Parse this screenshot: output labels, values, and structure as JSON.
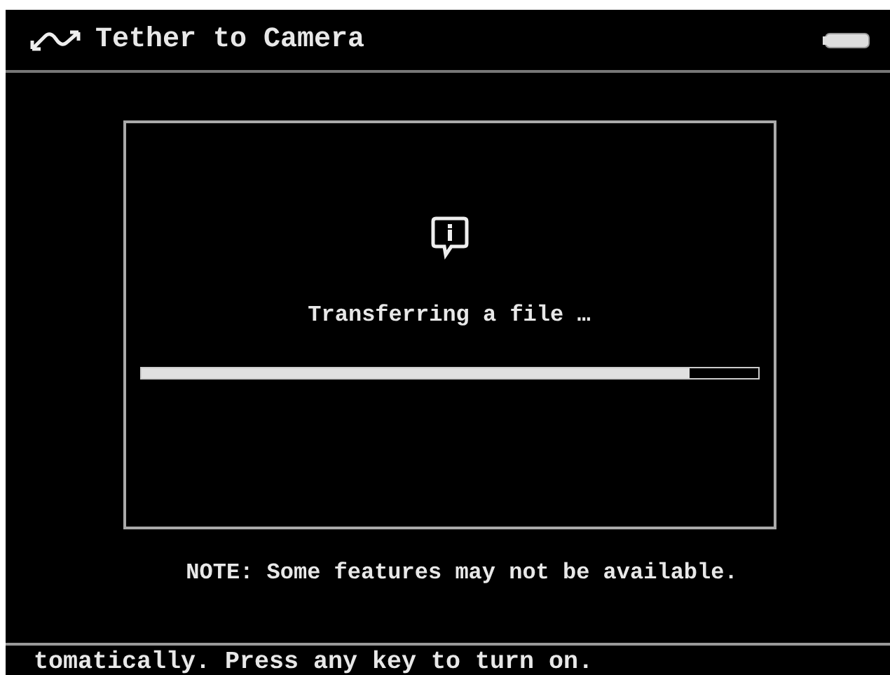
{
  "header": {
    "title": "Tether to Camera"
  },
  "dialog": {
    "message": "Transferring a file …",
    "progress": {
      "level": 0.89
    }
  },
  "note": "NOTE: Some features may not be available.",
  "status_bar": {
    "text": "tomatically. Press any key to turn on."
  }
}
